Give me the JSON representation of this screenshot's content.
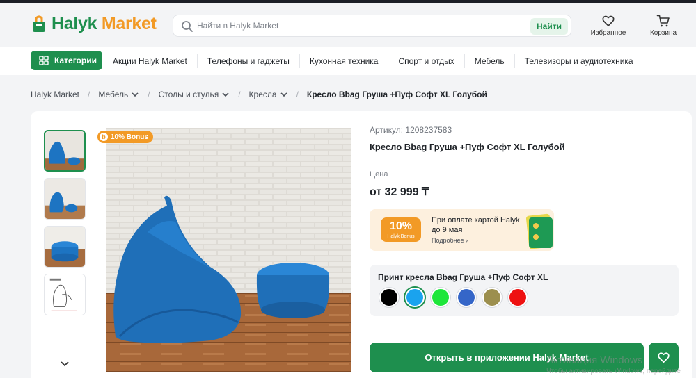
{
  "header": {
    "logo": {
      "part1": "Halyk",
      "part2": "Market"
    },
    "search": {
      "placeholder": "Найти в Halyk Market",
      "button": "Найти"
    },
    "favorites_label": "Избранное",
    "cart_label": "Корзина"
  },
  "nav": {
    "categories_label": "Категории",
    "items": [
      "Акции Halyk Market",
      "Телефоны и гаджеты",
      "Кухонная техника",
      "Спорт и отдых",
      "Мебель",
      "Телевизоры и аудиотехника"
    ]
  },
  "breadcrumb": {
    "items": [
      "Halyk Market",
      "Мебель",
      "Столы и стулья",
      "Кресла"
    ],
    "current": "Кресло Bbag Груша +Пуф Софт XL Голубой"
  },
  "product": {
    "bonus_badge": "10% Bonus",
    "article": "Артикул: 1208237583",
    "title": "Кресло Bbag Груша +Пуф Софт XL Голубой",
    "price_label": "Цена",
    "price": "от 32 999 ₸",
    "promo": {
      "percent": "10%",
      "percent_sub": "Halyk Bonus",
      "text": "При оплате картой Halyk до 9 мая",
      "more": "Подробнее ›"
    },
    "print_title": "Принт кресла Bbag Груша +Пуф Софт XL",
    "colors": [
      {
        "name": "black",
        "hex": "#000000",
        "selected": false
      },
      {
        "name": "light-blue",
        "hex": "#1aa3ee",
        "selected": true
      },
      {
        "name": "green",
        "hex": "#1ee63a",
        "selected": false
      },
      {
        "name": "blue",
        "hex": "#3566c8",
        "selected": false
      },
      {
        "name": "olive",
        "hex": "#9c8f4e",
        "selected": false
      },
      {
        "name": "red",
        "hex": "#ee1111",
        "selected": false
      }
    ],
    "open_app_label": "Открыть в приложении Halyk Market"
  },
  "watermark": {
    "title": "Активация Windows",
    "subtitle": "Чтобы активировать Windows, перейдите"
  },
  "colors": {
    "brand_green": "#1e8f4e",
    "bonus_orange": "#f29a26"
  }
}
